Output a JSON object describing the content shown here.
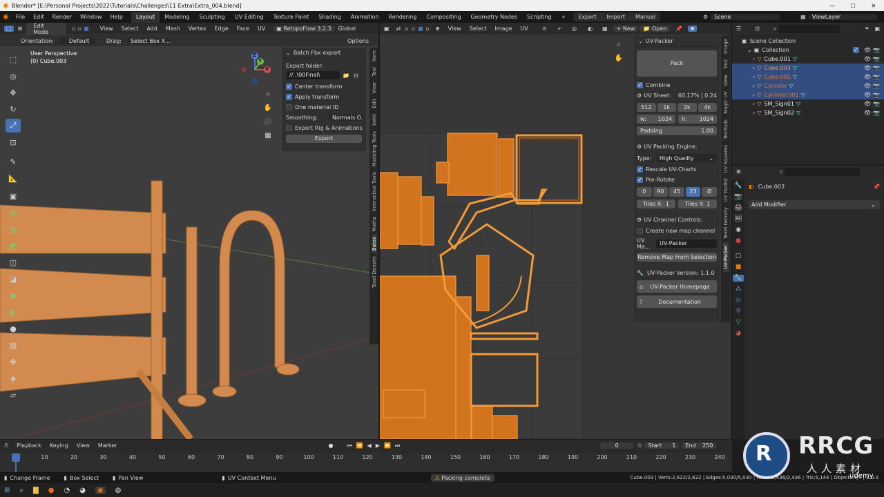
{
  "title_bar": {
    "title": "Blender* [E:\\Personal Projects\\2022\\Tutorials\\Challenges\\11 Extra\\Extra_004.blend]",
    "controls": [
      "—",
      "☐",
      "✕"
    ]
  },
  "top_menu": {
    "items": [
      "File",
      "Edit",
      "Render",
      "Window",
      "Help"
    ],
    "workspaces": [
      "Layout",
      "Modeling",
      "Sculpting",
      "UV Editing",
      "Texture Paint",
      "Shading",
      "Animation",
      "Rendering",
      "Compositing",
      "Geometry Nodes",
      "Scripting"
    ],
    "active_workspace": "Layout",
    "add_tab": "+",
    "io_buttons": [
      "Export",
      "Import",
      "Manual"
    ],
    "scene": "Scene",
    "view_layer": "ViewLayer"
  },
  "viewport": {
    "mode": "Edit Mode",
    "menus": [
      "View",
      "Select",
      "Add",
      "Mesh",
      "Vertex",
      "Edge",
      "Face",
      "UV"
    ],
    "retopo": "RetopoFlow 3.2.3",
    "global": "Global",
    "orientation_label": "Orientation:",
    "orientation_value": "Default",
    "drag_label": "Drag:",
    "drag_value": "Select Box X...",
    "options": "Options",
    "overlay_line1": "User Perspective",
    "overlay_line2": "(0) Cube.003",
    "gizmo": {
      "x": "X",
      "y": "Y",
      "z": "Z"
    }
  },
  "batch_export": {
    "header": "Batch Fbx export",
    "export_folder_label": "Export folder:",
    "export_folder_value": "//..\\00Final\\",
    "center_transform": "Center transform",
    "apply_transform": "Apply transform",
    "one_material_id": "One material ID",
    "smoothing_label": "Smoothing:",
    "smoothing_value": "Normals O...",
    "export_rig": "Export Rig & Animations",
    "export_button": "Export"
  },
  "viewport_tabs": [
    "Item",
    "Tool",
    "View",
    "Edit",
    "kekit",
    "Modeling Tools",
    "Interactive Tools",
    "Mathz",
    "Batex",
    "Texel Density"
  ],
  "uv_editor": {
    "menus": [
      "View",
      "Select",
      "Image",
      "UV"
    ],
    "new_button": "New",
    "open_button": "Open"
  },
  "uv_packer": {
    "header": "UV-Packer",
    "pack_button": "Pack",
    "combine": "Combine",
    "uv_sheet_label": "UV Sheet:",
    "uv_sheet_value": "60.17% | 0.24",
    "sizes": [
      "512",
      "1k",
      "2k",
      "4k"
    ],
    "w_label": "w:",
    "w_value": "1024",
    "h_label": "h:",
    "h_value": "1024",
    "padding_label": "Padding",
    "padding_value": "1.00",
    "packing_engine_header": "UV Packing Engine:",
    "type_label": "Type:",
    "type_value": "High Quality",
    "rescale": "Rescale UV-Charts",
    "prerotate": "Pre-Rotate",
    "rotations": [
      "0",
      "90",
      "45",
      "23",
      "Ø"
    ],
    "active_rotation": "23",
    "tiles_x_label": "Tiles X:",
    "tiles_x_value": "1",
    "tiles_y_label": "Tiles Y:",
    "tiles_y_value": "1",
    "channel_header": "UV Channel Controls:",
    "create_map": "Create new map channel",
    "uv_map_label": "UV Ma...",
    "uv_map_value": "UV-Packer",
    "remove_map": "Remove Map From Selection",
    "version": "UV-Packer Version: 1.1.0",
    "homepage": "UV-Packer Homepage",
    "documentation": "Documentation"
  },
  "uv_side_tabs": [
    "Image",
    "Tool",
    "View",
    "Magic UV",
    "TexTools",
    "UV Squares",
    "UV Toolkit",
    "Texel Density",
    "UV-Packer"
  ],
  "outliner": {
    "root": "Scene Collection",
    "collection": "Collection",
    "items": [
      {
        "name": "Cube.001",
        "color": "#e8e8e8",
        "selected": false
      },
      {
        "name": "Cube.003",
        "color": "#f0a040",
        "selected": true
      },
      {
        "name": "Cube.005",
        "color": "#e07830",
        "selected": true
      },
      {
        "name": "Cylinder",
        "color": "#e07830",
        "selected": true
      },
      {
        "name": "Cylinder.001",
        "color": "#e07830",
        "selected": true
      },
      {
        "name": "SM_Sign01",
        "color": "#e8e8e8",
        "selected": false
      },
      {
        "name": "SM_Sign02",
        "color": "#e8e8e8",
        "selected": false
      }
    ]
  },
  "properties": {
    "object": "Cube.003",
    "add_modifier": "Add Modifier"
  },
  "timeline": {
    "menus": [
      "Playback",
      "Keying",
      "View",
      "Marker"
    ],
    "current_frame": "0",
    "start_label": "Start",
    "start_value": "1",
    "end_label": "End",
    "end_value": "250",
    "ticks": [
      "0",
      "10",
      "20",
      "30",
      "40",
      "50",
      "60",
      "70",
      "80",
      "90",
      "100",
      "110",
      "120",
      "130",
      "140",
      "150",
      "160",
      "170",
      "180",
      "190",
      "200",
      "210",
      "220",
      "230",
      "240"
    ]
  },
  "status_bar": {
    "change_frame": "Change Frame",
    "box_select": "Box Select",
    "pan_view": "Pan View",
    "uv_context": "UV Context Menu",
    "message": "Packing complete",
    "stats": "Cube.003 | Verts:2,622/2,622 | Edges:5,030/5,030 | Faces:2,436/2,436 | Tris:5,144 | Objects:4/7 | 3.0.0"
  },
  "watermark": {
    "brand": "RRCG",
    "sub": "人人素材",
    "udemy": "udemy"
  },
  "colors": {
    "accent": "#4772b3",
    "uv_orange": "#e07a1e",
    "mesh_orange": "#d38a4e",
    "selected_row": "#334d80"
  }
}
